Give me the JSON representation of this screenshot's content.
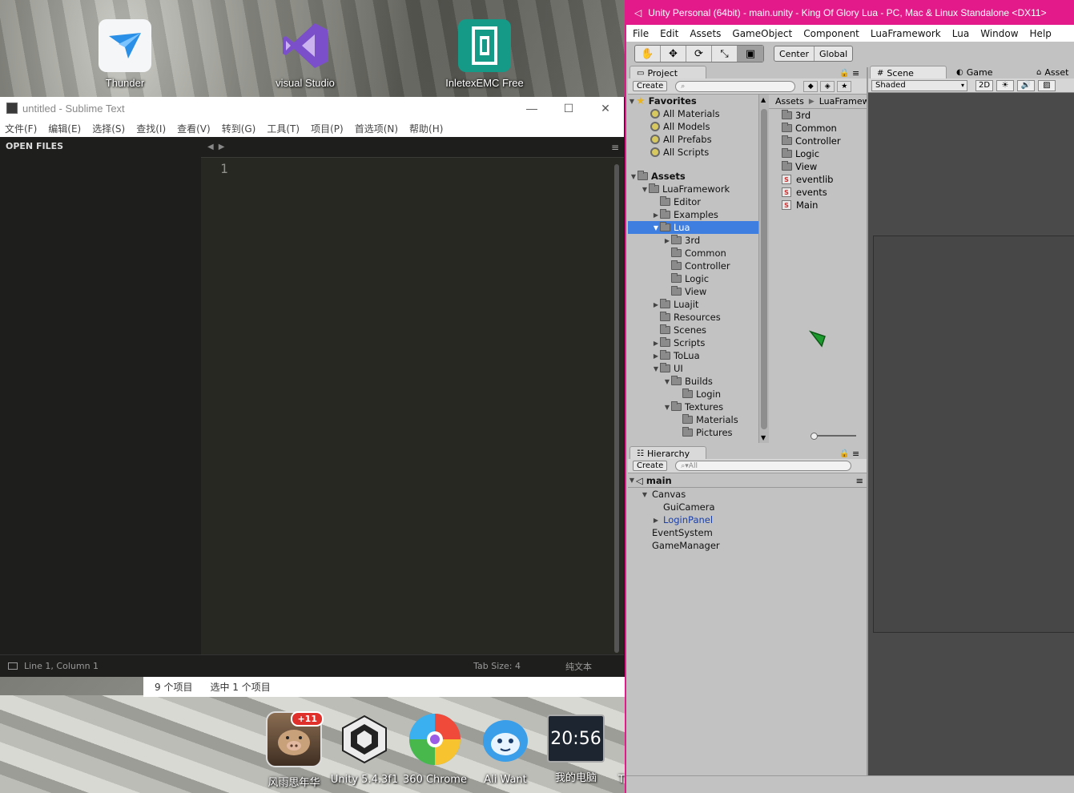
{
  "desktop": {
    "icons": [
      {
        "label": "Thunder",
        "icon": "thunder-bird-icon"
      },
      {
        "label": "visual Studio",
        "icon": "visual-studio-icon"
      },
      {
        "label": "InletexEMC Free",
        "icon": "inletex-icon"
      }
    ],
    "dock": [
      {
        "label": "风雨思年华",
        "icon": "pig-avatar-icon",
        "badge": "+11"
      },
      {
        "label": "Unity 5.4.3f1",
        "icon": "unity-icon"
      },
      {
        "label": "360 Chrome",
        "icon": "chrome360-icon"
      },
      {
        "label": "Ali Want",
        "icon": "aliwangwang-icon"
      },
      {
        "label": "我的电脑",
        "icon": "computer-icon",
        "clock": "20:56"
      },
      {
        "label": "T"
      }
    ]
  },
  "sublime": {
    "title": "untitled - Sublime Text",
    "menu": [
      "文件(F)",
      "编辑(E)",
      "选择(S)",
      "查找(I)",
      "查看(V)",
      "转到(G)",
      "工具(T)",
      "项目(P)",
      "首选项(N)",
      "帮助(H)"
    ],
    "sidebar_header": "OPEN FILES",
    "line_number": "1",
    "status": {
      "position": "Line 1, Column 1",
      "tab_size": "Tab Size: 4",
      "syntax": "纯文本"
    }
  },
  "explorer": {
    "item_count": "9 个项目",
    "selected": "选中 1 个项目"
  },
  "unity": {
    "title": "Unity Personal (64bit) - main.unity - King Of Glory Lua - PC, Mac & Linux Standalone <DX11>",
    "menu": [
      "File",
      "Edit",
      "Assets",
      "GameObject",
      "Component",
      "LuaFramework",
      "Lua",
      "Window",
      "Help"
    ],
    "toolbar": {
      "pivot": "Center",
      "space": "Global"
    },
    "project": {
      "tab": "Project",
      "create": "Create",
      "favorites_label": "Favorites",
      "favorites": [
        "All Materials",
        "All Models",
        "All Prefabs",
        "All Scripts"
      ],
      "tree": [
        {
          "label": "Assets",
          "depth": 0,
          "expanded": true,
          "bold": true
        },
        {
          "label": "LuaFramework",
          "depth": 1,
          "expanded": true
        },
        {
          "label": "Editor",
          "depth": 2
        },
        {
          "label": "Examples",
          "depth": 2,
          "collapsed": true
        },
        {
          "label": "Lua",
          "depth": 2,
          "expanded": true,
          "selected": true
        },
        {
          "label": "3rd",
          "depth": 3,
          "collapsed": true
        },
        {
          "label": "Common",
          "depth": 3
        },
        {
          "label": "Controller",
          "depth": 3
        },
        {
          "label": "Logic",
          "depth": 3
        },
        {
          "label": "View",
          "depth": 3
        },
        {
          "label": "Luajit",
          "depth": 2,
          "collapsed": true
        },
        {
          "label": "Resources",
          "depth": 2
        },
        {
          "label": "Scenes",
          "depth": 2
        },
        {
          "label": "Scripts",
          "depth": 2,
          "collapsed": true
        },
        {
          "label": "ToLua",
          "depth": 2,
          "collapsed": true
        },
        {
          "label": "UI",
          "depth": 2,
          "expanded": true
        },
        {
          "label": "Builds",
          "depth": 3,
          "expanded": true
        },
        {
          "label": "Login",
          "depth": 4
        },
        {
          "label": "Textures",
          "depth": 3,
          "expanded": true
        },
        {
          "label": "Materials",
          "depth": 4
        },
        {
          "label": "Pictures",
          "depth": 4
        }
      ],
      "breadcrumb": [
        "Assets",
        "LuaFramew"
      ],
      "assets": [
        {
          "label": "3rd",
          "type": "folder"
        },
        {
          "label": "Common",
          "type": "folder"
        },
        {
          "label": "Controller",
          "type": "folder"
        },
        {
          "label": "Logic",
          "type": "folder"
        },
        {
          "label": "View",
          "type": "folder"
        },
        {
          "label": "eventlib",
          "type": "lua"
        },
        {
          "label": "events",
          "type": "lua"
        },
        {
          "label": "Main",
          "type": "lua"
        }
      ]
    },
    "hierarchy": {
      "tab": "Hierarchy",
      "create": "Create",
      "search_placeholder": "All",
      "scene": "main",
      "items": [
        {
          "label": "Canvas",
          "depth": 1,
          "expanded": true
        },
        {
          "label": "GuiCamera",
          "depth": 2
        },
        {
          "label": "LoginPanel",
          "depth": 2,
          "collapsed": true,
          "prefab": true
        },
        {
          "label": "EventSystem",
          "depth": 1
        },
        {
          "label": "GameManager",
          "depth": 1
        }
      ]
    },
    "scene": {
      "tabs": [
        "Scene",
        "Game",
        "Asset"
      ],
      "shading": "Shaded",
      "mode_2d": "2D"
    }
  }
}
